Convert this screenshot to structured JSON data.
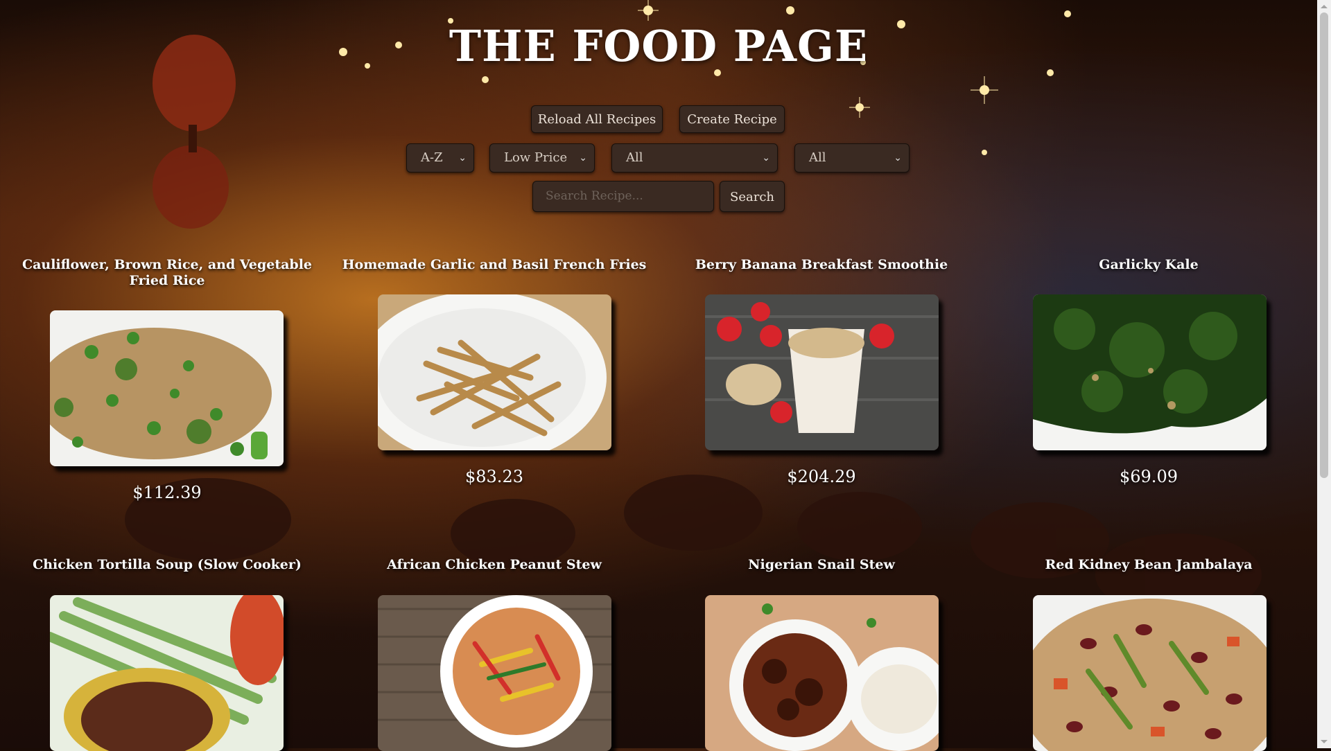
{
  "page": {
    "title": "THE FOOD PAGE"
  },
  "actions": {
    "reload_label": "Reload All Recipes",
    "create_label": "Create Recipe"
  },
  "filters": {
    "sort_alpha": {
      "selected": "A-Z"
    },
    "sort_price": {
      "selected": "Low Price"
    },
    "filter_one": {
      "selected": "All"
    },
    "filter_two": {
      "selected": "All"
    }
  },
  "search": {
    "placeholder": "Search Recipe...",
    "button_label": "Search"
  },
  "recipes": [
    {
      "title": "Cauliflower, Brown Rice, and Vegetable Fried Rice",
      "price": "$112.39",
      "image": "fried-rice-image"
    },
    {
      "title": "Homemade Garlic and Basil French Fries",
      "price": "$83.23",
      "image": "french-fries-image"
    },
    {
      "title": "Berry Banana Breakfast Smoothie",
      "price": "$204.29",
      "image": "smoothie-image"
    },
    {
      "title": "Garlicky Kale",
      "price": "$69.09",
      "image": "kale-image"
    },
    {
      "title": "Chicken Tortilla Soup (Slow Cooker)",
      "image": "tortilla-soup-image"
    },
    {
      "title": "African Chicken Peanut Stew",
      "image": "peanut-stew-image"
    },
    {
      "title": "Nigerian Snail Stew",
      "image": "snail-stew-image"
    },
    {
      "title": "Red Kidney Bean Jambalaya",
      "image": "jambalaya-image"
    }
  ],
  "colors": {
    "control_bg": "#3a2a22",
    "text": "#ffffff",
    "scroll_track": "#f1f1f1",
    "scroll_thumb": "#c1c1c1"
  }
}
